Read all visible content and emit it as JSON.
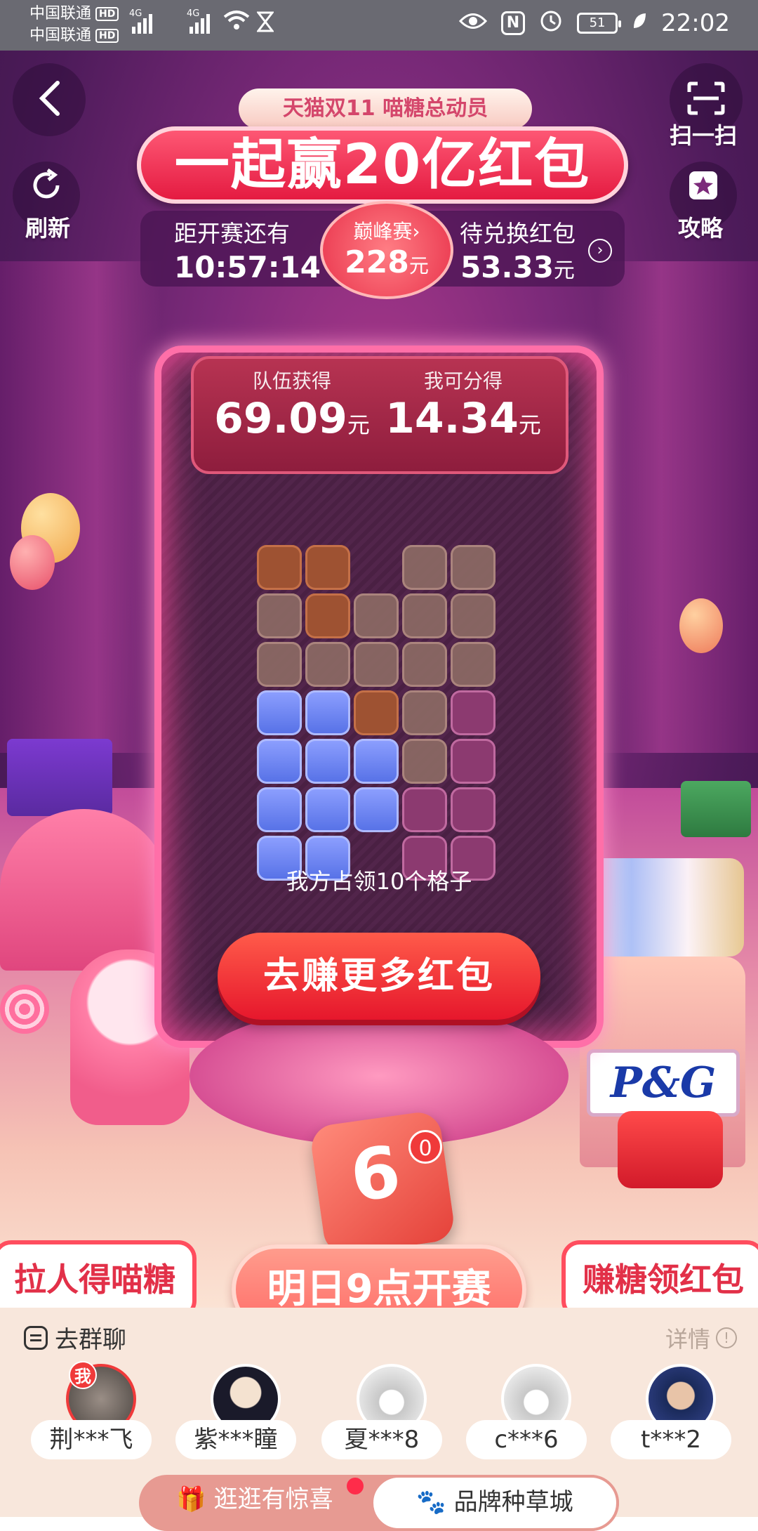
{
  "status_bar": {
    "carrier1": "中国联通",
    "carrier2": "中国联通",
    "hd": "HD",
    "net1": "4G",
    "net2": "4G",
    "nfc": "N",
    "battery": "51",
    "time": "22:02"
  },
  "header": {
    "event_tag": "天猫双11 喵糖总动员",
    "headline": "一起赢20亿红包",
    "scan_label": "扫一扫",
    "refresh_label": "刷新",
    "guide_label": "攻略"
  },
  "info_bar": {
    "countdown_label": "距开赛还有",
    "countdown_value": "10:57:14",
    "peak_label": "巅峰赛›",
    "peak_value": "228",
    "peak_unit": "元",
    "pending_label": "待兑换红包",
    "pending_value": "53.33",
    "pending_unit": "元"
  },
  "board": {
    "team_label": "队伍获得",
    "team_value": "69.09",
    "team_unit": "元",
    "my_label": "我可分得",
    "my_value": "14.34",
    "my_unit": "元",
    "occupied_text": "我方占领10个格子",
    "cta_label": "去赚更多红包"
  },
  "dice": {
    "face": "6",
    "count_badge": "0",
    "start_text": "明日9点开赛"
  },
  "side_buttons": {
    "invite": "拉人得喵糖",
    "earn": "赚糖领红包"
  },
  "brand": {
    "logo_text": "P&G"
  },
  "team": {
    "group_chat": "去群聊",
    "details": "详情",
    "me_badge": "我",
    "members": [
      {
        "name": "荆***飞"
      },
      {
        "name": "紫***瞳"
      },
      {
        "name": "夏***8"
      },
      {
        "name": "c***6"
      },
      {
        "name": "t***2"
      }
    ]
  },
  "bottom_tabs": {
    "tab1": "逛逛有惊喜",
    "tab2": "品牌种草城"
  }
}
